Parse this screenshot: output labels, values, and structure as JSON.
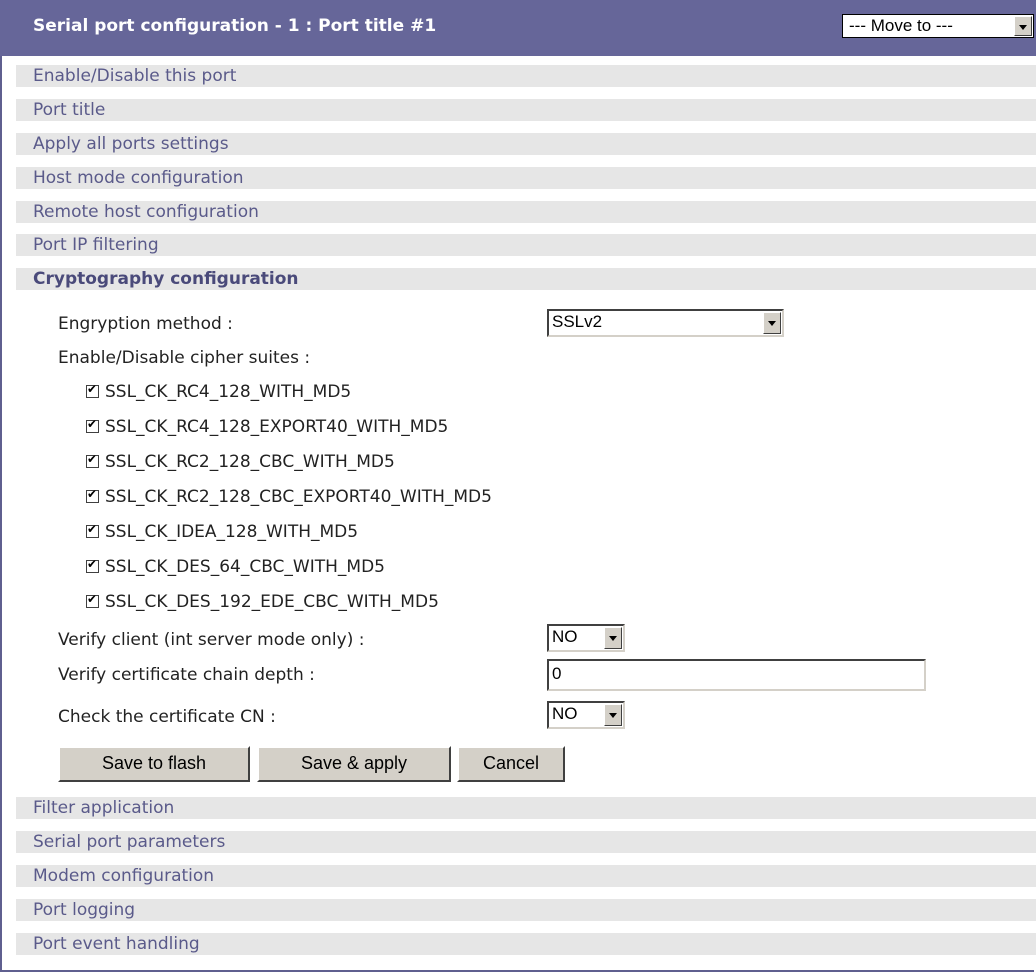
{
  "header": {
    "title": "Serial port configuration - 1 : Port title #1",
    "move_to": "--- Move to ---"
  },
  "sections_top": [
    "Enable/Disable this port",
    "Port title",
    "Apply all ports settings",
    "Host mode configuration",
    "Remote host configuration",
    "Port IP filtering",
    "Cryptography configuration"
  ],
  "crypto": {
    "encryption_label": "Engryption method :",
    "encryption_value": "SSLv2",
    "cipher_label": "Enable/Disable cipher suites :",
    "ciphers": [
      {
        "name": "SSL_CK_RC4_128_WITH_MD5",
        "checked": true
      },
      {
        "name": "SSL_CK_RC4_128_EXPORT40_WITH_MD5",
        "checked": true
      },
      {
        "name": "SSL_CK_RC2_128_CBC_WITH_MD5",
        "checked": true
      },
      {
        "name": "SSL_CK_RC2_128_CBC_EXPORT40_WITH_MD5",
        "checked": true
      },
      {
        "name": "SSL_CK_IDEA_128_WITH_MD5",
        "checked": true
      },
      {
        "name": "SSL_CK_DES_64_CBC_WITH_MD5",
        "checked": true
      },
      {
        "name": "SSL_CK_DES_192_EDE_CBC_WITH_MD5",
        "checked": true
      }
    ],
    "verify_client_label": "Verify client (int server mode only) :",
    "verify_client_value": "NO",
    "chain_depth_label": "Verify certificate chain depth :",
    "chain_depth_value": "0",
    "check_cn_label": "Check the certificate CN :",
    "check_cn_value": "NO"
  },
  "buttons": {
    "save_flash": "Save to flash",
    "save_apply": "Save & apply",
    "cancel": "Cancel"
  },
  "sections_bottom": [
    "Filter application",
    "Serial port parameters",
    "Modem configuration",
    "Port logging",
    "Port event handling"
  ]
}
